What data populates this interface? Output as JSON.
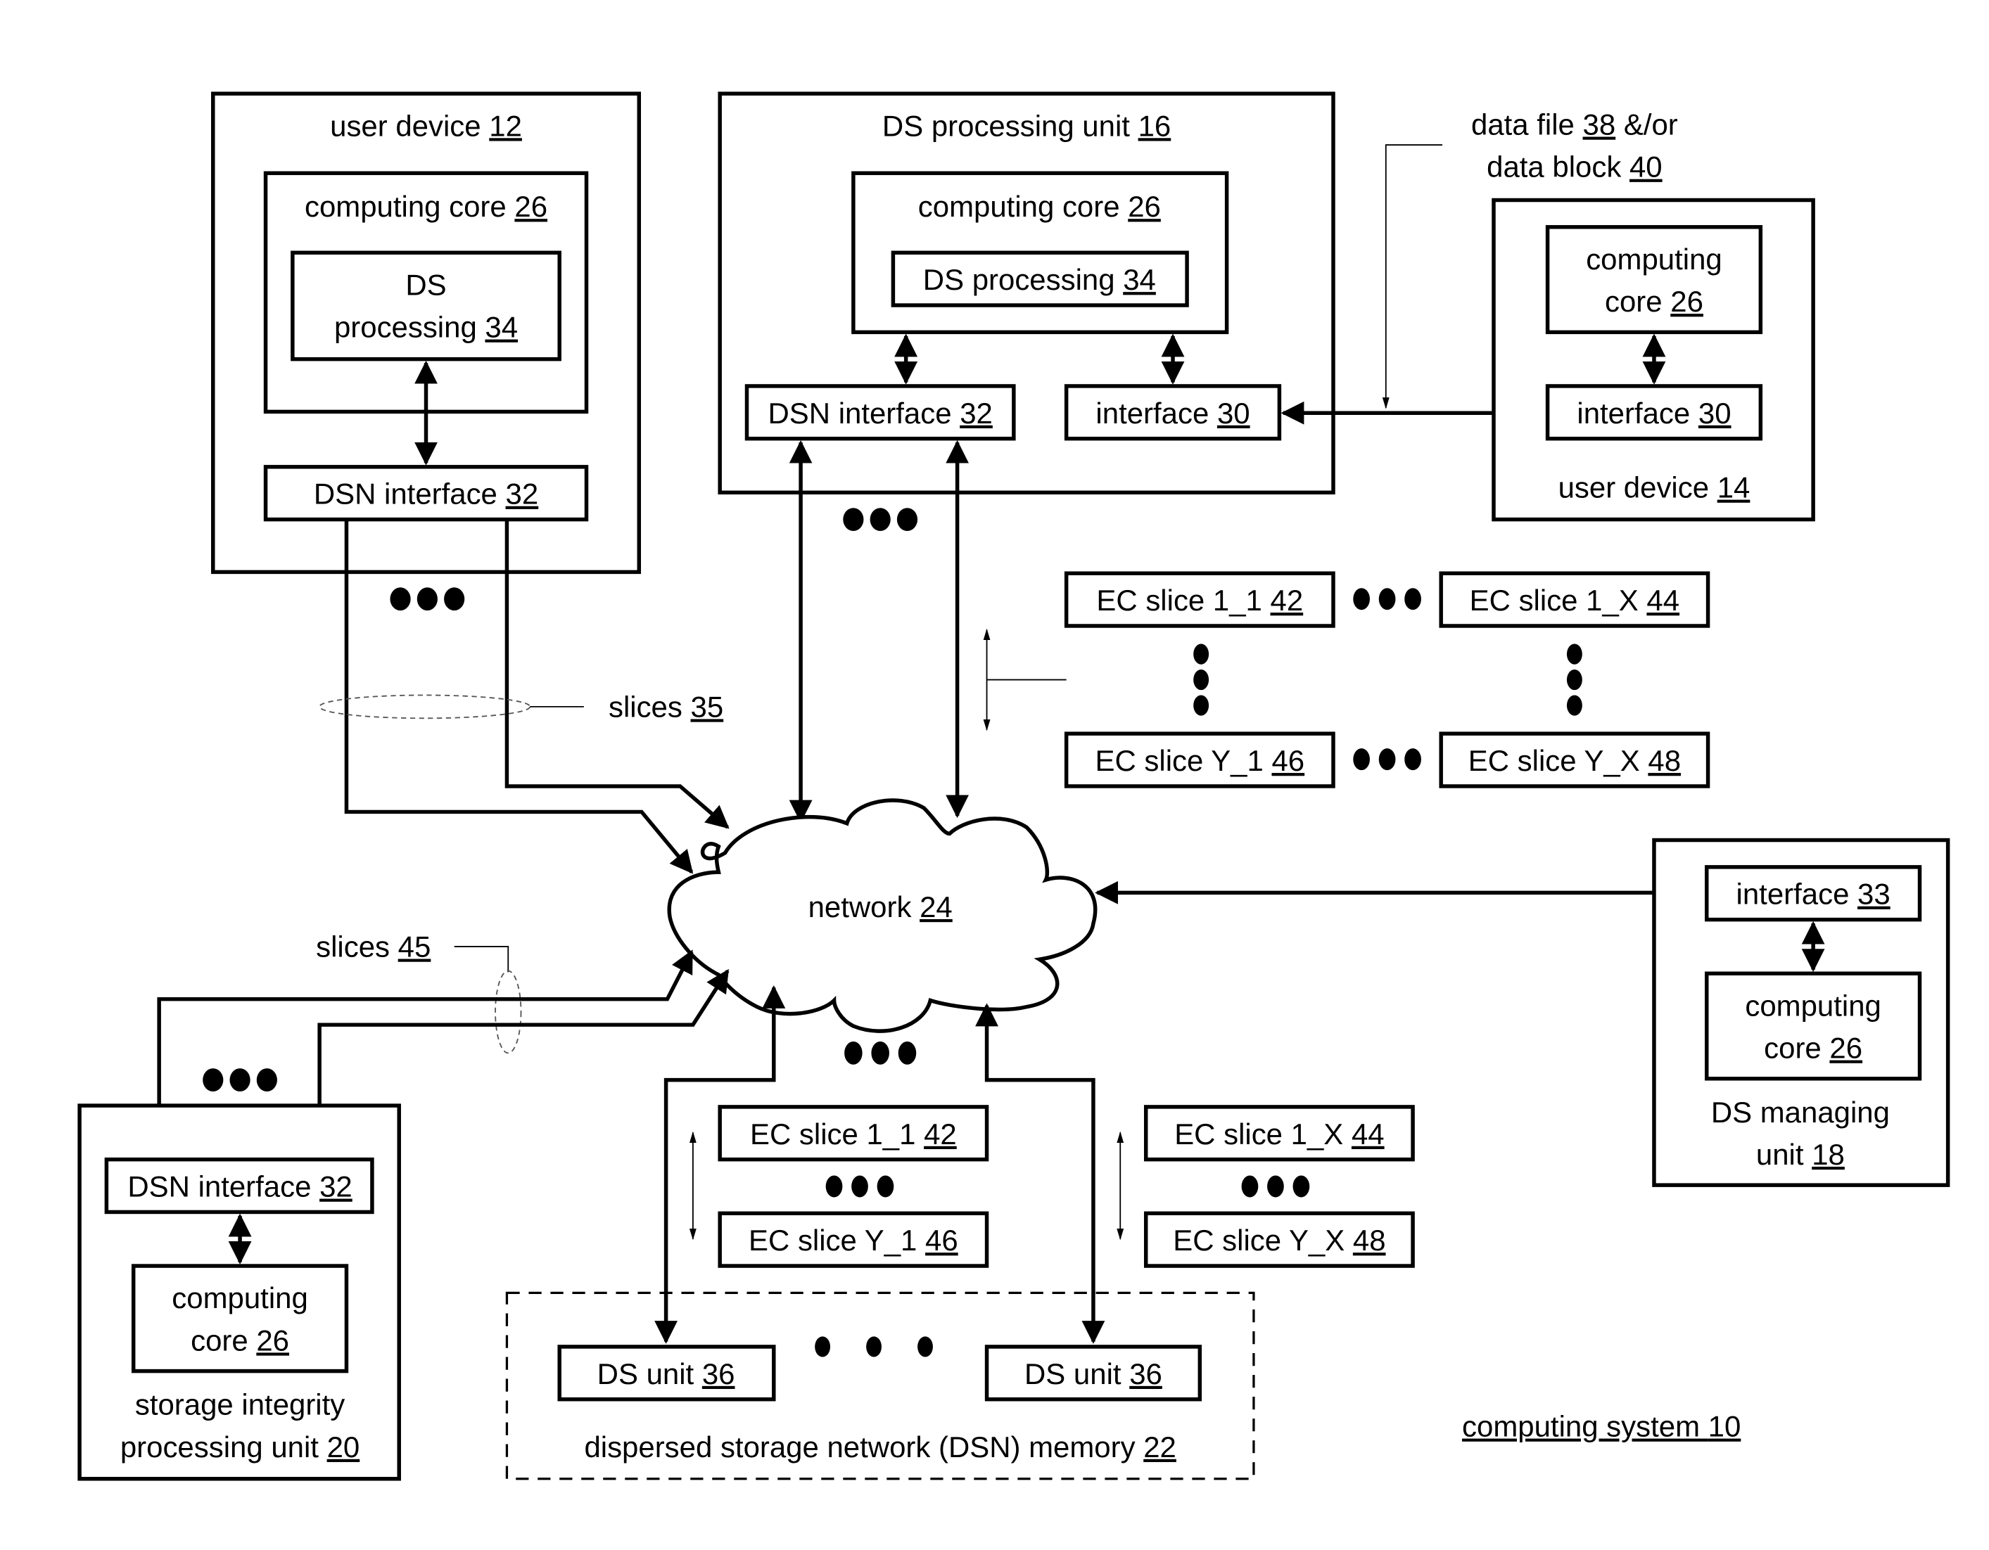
{
  "title": "computing system",
  "title_ref": "10",
  "components": {
    "user_device_12": {
      "label": "user device",
      "ref": "12",
      "computing_core": {
        "label": "computing core",
        "ref": "26"
      },
      "ds_processing": {
        "line1": "DS",
        "line2": "processing",
        "ref": "34"
      },
      "dsn_interface": {
        "label": "DSN interface",
        "ref": "32"
      }
    },
    "ds_processing_unit_16": {
      "label": "DS processing unit",
      "ref": "16",
      "computing_core": {
        "label": "computing core",
        "ref": "26"
      },
      "ds_processing": {
        "label": "DS processing",
        "ref": "34"
      },
      "dsn_interface": {
        "label": "DSN interface",
        "ref": "32"
      },
      "interface": {
        "label": "interface",
        "ref": "30"
      }
    },
    "user_device_14": {
      "label": "user device",
      "ref": "14",
      "computing_core": {
        "line1": "computing",
        "line2": "core",
        "ref": "26"
      },
      "interface": {
        "label": "interface",
        "ref": "30"
      }
    },
    "data_annotation": {
      "line1_a": "data file",
      "line1_ref": "38",
      "line1_b": "&/or",
      "line2": "data block",
      "line2_ref": "40"
    },
    "network_24": {
      "label": "network",
      "ref": "24"
    },
    "slices_35": {
      "label": "slices",
      "ref": "35"
    },
    "slices_45": {
      "label": "slices",
      "ref": "45"
    },
    "ec_grid_top": [
      {
        "label": "EC slice 1_1",
        "ref": "42"
      },
      {
        "label": "EC slice 1_X",
        "ref": "44"
      },
      {
        "label": "EC slice Y_1",
        "ref": "46"
      },
      {
        "label": "EC slice Y_X",
        "ref": "48"
      }
    ],
    "ec_bottom_left": [
      {
        "label": "EC slice 1_1",
        "ref": "42"
      },
      {
        "label": "EC slice Y_1",
        "ref": "46"
      }
    ],
    "ec_bottom_right": [
      {
        "label": "EC slice 1_X",
        "ref": "44"
      },
      {
        "label": "EC slice Y_X",
        "ref": "48"
      }
    ],
    "ds_managing_unit_18": {
      "line1": "DS managing",
      "line2": "unit",
      "ref": "18",
      "interface": {
        "label": "interface",
        "ref": "33"
      },
      "computing_core": {
        "line1": "computing",
        "line2": "core",
        "ref": "26"
      }
    },
    "storage_integrity_unit_20": {
      "line1": "storage integrity",
      "line2": "processing unit",
      "ref": "20",
      "dsn_interface": {
        "label": "DSN interface",
        "ref": "32"
      },
      "computing_core": {
        "line1": "computing",
        "line2": "core",
        "ref": "26"
      }
    },
    "dsn_memory_22": {
      "label": "dispersed storage network (DSN) memory",
      "ref": "22",
      "ds_units": [
        {
          "label": "DS unit",
          "ref": "36"
        },
        {
          "label": "DS unit",
          "ref": "36"
        }
      ]
    }
  }
}
